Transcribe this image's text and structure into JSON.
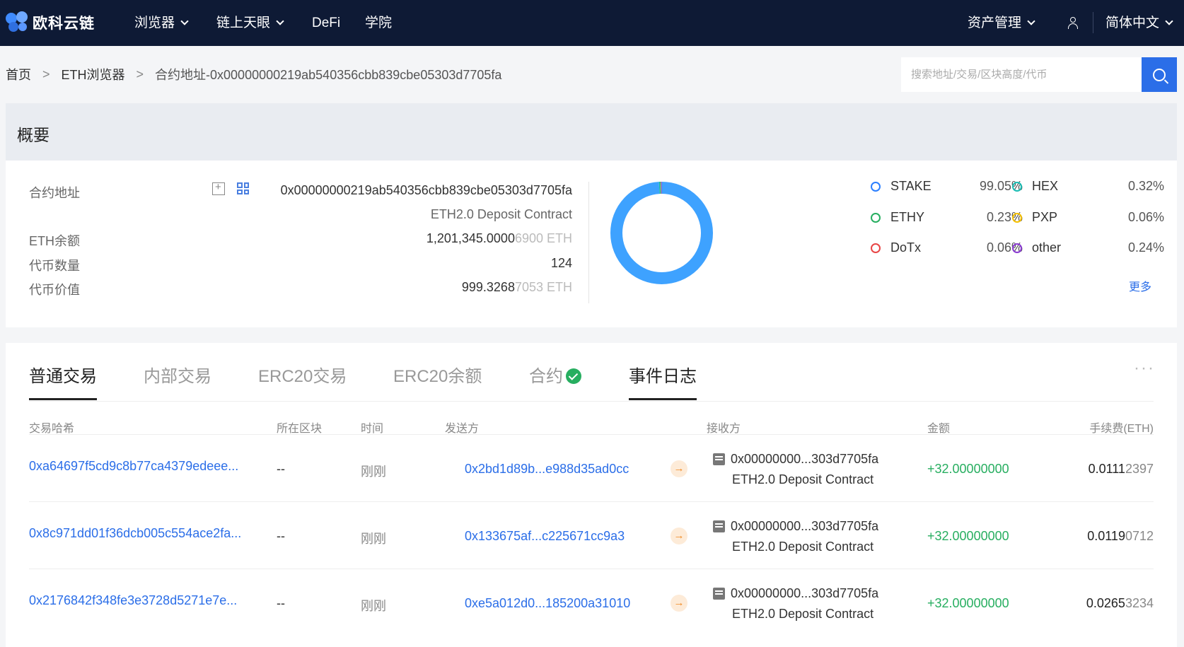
{
  "nav": {
    "logo_text": "欧科云链",
    "items": [
      {
        "label": "浏览器",
        "dropdown": true
      },
      {
        "label": "链上天眼",
        "dropdown": true
      },
      {
        "label": "DeFi",
        "dropdown": false
      },
      {
        "label": "学院",
        "dropdown": false
      }
    ],
    "asset_mgmt": "资产管理",
    "language": "简体中文"
  },
  "breadcrumb": {
    "home": "首页",
    "explorer": "ETH浏览器",
    "current": "合约地址-0x00000000219ab540356cbb839cbe05303d7705fa",
    "separator": ">"
  },
  "search": {
    "placeholder": "搜索地址/交易/区块高度/代币"
  },
  "overview": {
    "title": "概要",
    "contract_label": "合约地址",
    "contract_address": "0x00000000219ab540356cbb839cbe05303d7705fa",
    "contract_name": "ETH2.0 Deposit Contract",
    "eth_balance_label": "ETH余额",
    "eth_balance_main": "1,201,345.0000",
    "eth_balance_dim": "6900 ETH",
    "token_count_label": "代币数量",
    "token_count": "124",
    "token_value_label": "代币价值",
    "token_value_main": "999.3268",
    "token_value_dim": "7053 ETH",
    "more": "更多"
  },
  "token_distribution": {
    "legend": [
      {
        "name": "STAKE",
        "pct": "99.05%",
        "value": 99.05,
        "color": "#2b7fff"
      },
      {
        "name": "HEX",
        "pct": "0.32%",
        "value": 0.32,
        "color": "#1bbcb3"
      },
      {
        "name": "ETHY",
        "pct": "0.23%",
        "value": 0.23,
        "color": "#27ae60"
      },
      {
        "name": "PXP",
        "pct": "0.06%",
        "value": 0.06,
        "color": "#f5c000"
      },
      {
        "name": "DoTx",
        "pct": "0.06%",
        "value": 0.06,
        "color": "#e84545"
      },
      {
        "name": "other",
        "pct": "0.24%",
        "value": 0.24,
        "color": "#8a3bd1"
      }
    ]
  },
  "tabs": [
    {
      "label": "普通交易",
      "active": true
    },
    {
      "label": "内部交易",
      "active": false
    },
    {
      "label": "ERC20交易",
      "active": false
    },
    {
      "label": "ERC20余额",
      "active": false
    },
    {
      "label": "合约",
      "active": false,
      "verified": true
    },
    {
      "label": "事件日志",
      "active": true
    }
  ],
  "table": {
    "headers": {
      "hash": "交易哈希",
      "block": "所在区块",
      "time": "时间",
      "from": "发送方",
      "to": "接收方",
      "amount": "金额",
      "fee": "手续费(ETH)"
    },
    "rows": [
      {
        "hash": "0xa64697f5cd9c8b77ca4379edeee...",
        "block": "--",
        "time": "刚刚",
        "from": "0x2bd1d89b...e988d35ad0cc",
        "to_addr": "0x00000000...303d7705fa",
        "to_name": "ETH2.0 Deposit Contract",
        "amount": "+32.00000000",
        "fee_main": "0.0111",
        "fee_dim": "2397"
      },
      {
        "hash": "0x8c971dd01f36dcb005c554ace2fa...",
        "block": "--",
        "time": "刚刚",
        "from": "0x133675af...c225671cc9a3",
        "to_addr": "0x00000000...303d7705fa",
        "to_name": "ETH2.0 Deposit Contract",
        "amount": "+32.00000000",
        "fee_main": "0.0119",
        "fee_dim": "0712"
      },
      {
        "hash": "0x2176842f348fe3e3728d5271e7e...",
        "block": "--",
        "time": "刚刚",
        "from": "0xe5a012d0...185200a31010",
        "to_addr": "0x00000000...303d7705fa",
        "to_name": "ETH2.0 Deposit Contract",
        "amount": "+32.00000000",
        "fee_main": "0.0265",
        "fee_dim": "3234"
      }
    ]
  }
}
